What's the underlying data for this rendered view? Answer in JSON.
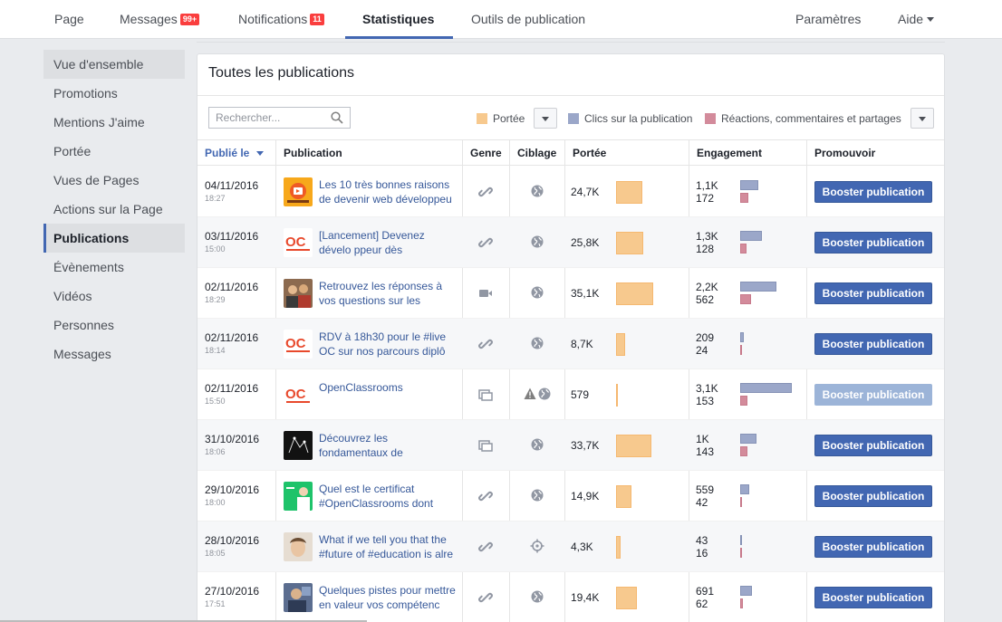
{
  "nav": {
    "page": "Page",
    "messages": "Messages",
    "messages_badge": "99+",
    "notifications": "Notifications",
    "notifications_badge": "11",
    "statistiques": "Statistiques",
    "outils": "Outils de publication",
    "parametres": "Paramètres",
    "aide": "Aide"
  },
  "sidebar": {
    "items": [
      {
        "label": "Vue d'ensemble"
      },
      {
        "label": "Promotions"
      },
      {
        "label": "Mentions J'aime"
      },
      {
        "label": "Portée"
      },
      {
        "label": "Vues de Pages"
      },
      {
        "label": "Actions sur la Page"
      },
      {
        "label": "Publications"
      },
      {
        "label": "Évènements"
      },
      {
        "label": "Vidéos"
      },
      {
        "label": "Personnes"
      },
      {
        "label": "Messages"
      }
    ],
    "active_index": 6
  },
  "main": {
    "title": "Toutes les publications",
    "search_placeholder": "Rechercher...",
    "legend": {
      "portee": "Portée",
      "clics": "Clics sur la publication",
      "reactions": "Réactions, commentaires et partages"
    },
    "colors": {
      "portee": "#f7c98e",
      "clics": "#9ba7c9",
      "reactions": "#d38b9b",
      "accent": "#4267b2"
    },
    "columns": {
      "publie": "Publié le",
      "publication": "Publication",
      "genre": "Genre",
      "ciblage": "Ciblage",
      "portee": "Portée",
      "engagement": "Engagement",
      "promouvoir": "Promouvoir"
    },
    "boost_label": "Booster publication"
  },
  "rows": [
    {
      "date": "04/11/2016",
      "time": "18:27",
      "text": "Les 10 très bonnes raisons de devenir web développeu",
      "genre": "link-icon",
      "ciblage": "globe-icon",
      "reach": "24,7K",
      "reach_value": 24700,
      "clicks": "1,1K",
      "clicks_value": 1100,
      "reactions": "172",
      "reactions_value": 172,
      "boost_enabled": true,
      "thumb": "orange"
    },
    {
      "date": "03/11/2016",
      "time": "15:00",
      "text": "[Lancement] Devenez dévelo ppeur dès maintenant ave",
      "genre": "link-icon",
      "ciblage": "globe-icon",
      "reach": "25,8K",
      "reach_value": 25800,
      "clicks": "1,3K",
      "clicks_value": 1300,
      "reactions": "128",
      "reactions_value": 128,
      "boost_enabled": true,
      "thumb": "oc"
    },
    {
      "date": "02/11/2016",
      "time": "18:29",
      "text": "Retrouvez les réponses à vos questions sur les parcou",
      "genre": "video-icon",
      "ciblage": "globe-icon",
      "reach": "35,1K",
      "reach_value": 35100,
      "clicks": "2,2K",
      "clicks_value": 2200,
      "reactions": "562",
      "reactions_value": 562,
      "boost_enabled": true,
      "thumb": "people"
    },
    {
      "date": "02/11/2016",
      "time": "18:14",
      "text": "RDV à 18h30 pour le #live OC sur nos parcours diplô",
      "genre": "link-icon",
      "ciblage": "globe-icon",
      "reach": "8,7K",
      "reach_value": 8700,
      "clicks": "209",
      "clicks_value": 209,
      "reactions": "24",
      "reactions_value": 24,
      "boost_enabled": true,
      "thumb": "oc"
    },
    {
      "date": "02/11/2016",
      "time": "15:50",
      "text": "OpenClassrooms",
      "genre": "album-icon",
      "ciblage": "warning-globe-icon",
      "reach": "579",
      "reach_value": 579,
      "clicks": "3,1K",
      "clicks_value": 3100,
      "reactions": "153",
      "reactions_value": 153,
      "boost_enabled": false,
      "thumb": "oc"
    },
    {
      "date": "31/10/2016",
      "time": "18:06",
      "text": "Découvrez les fondamentaux de l'#UXDesign, et comp",
      "genre": "album-icon",
      "ciblage": "globe-icon",
      "reach": "33,7K",
      "reach_value": 33700,
      "clicks": "1K",
      "clicks_value": 1000,
      "reactions": "143",
      "reactions_value": 143,
      "boost_enabled": true,
      "thumb": "dark"
    },
    {
      "date": "29/10/2016",
      "time": "18:00",
      "text": "Quel est le certificat #OpenClassrooms dont vous êtes",
      "genre": "link-icon",
      "ciblage": "globe-icon",
      "reach": "14,9K",
      "reach_value": 14900,
      "clicks": "559",
      "clicks_value": 559,
      "reactions": "42",
      "reactions_value": 42,
      "boost_enabled": true,
      "thumb": "green"
    },
    {
      "date": "28/10/2016",
      "time": "18:05",
      "text": "What if we tell you that the #future of #education is alre",
      "genre": "link-icon",
      "ciblage": "target-icon",
      "reach": "4,3K",
      "reach_value": 4300,
      "clicks": "43",
      "clicks_value": 43,
      "reactions": "16",
      "reactions_value": 16,
      "boost_enabled": true,
      "thumb": "face"
    },
    {
      "date": "27/10/2016",
      "time": "17:51",
      "text": "Quelques pistes pour mettre en valeur vos compétenc",
      "genre": "link-icon",
      "ciblage": "globe-icon",
      "reach": "19,4K",
      "reach_value": 19400,
      "clicks": "691",
      "clicks_value": 691,
      "reactions": "62",
      "reactions_value": 62,
      "boost_enabled": true,
      "thumb": "blue"
    }
  ]
}
